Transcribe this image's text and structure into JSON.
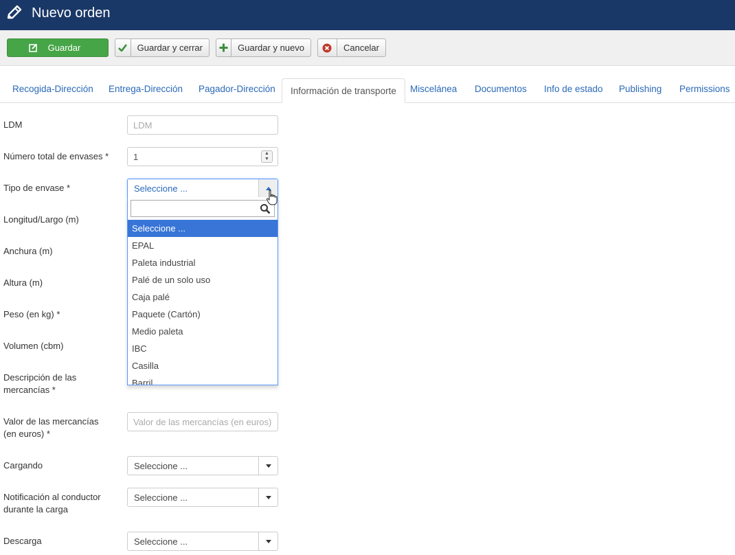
{
  "header": {
    "title": "Nuevo orden"
  },
  "toolbar": {
    "save_label": "Guardar",
    "save_close_label": "Guardar y cerrar",
    "save_new_label": "Guardar y nuevo",
    "cancel_label": "Cancelar"
  },
  "tabs": [
    {
      "label": "Recogida-Dirección"
    },
    {
      "label": "Entrega-Dirección"
    },
    {
      "label": "Pagador-Dirección"
    },
    {
      "label": "Información de transporte"
    },
    {
      "label": "Miscelánea"
    },
    {
      "label": "Documentos"
    },
    {
      "label": "Info de estado"
    },
    {
      "label": "Publishing"
    },
    {
      "label": "Permissions"
    }
  ],
  "form": {
    "ldm": {
      "label": "LDM",
      "placeholder": "LDM",
      "value": ""
    },
    "total_packages": {
      "label": "Número total de envases *",
      "value": "1"
    },
    "package_type": {
      "label": "Tipo de envase *",
      "value": "Seleccione ...",
      "options": [
        "Seleccione ...",
        "EPAL",
        "Paleta industrial",
        "Palé de un solo uso",
        "Caja palé",
        "Paquete (Cartón)",
        "Medio paleta",
        "IBC",
        "Casilla",
        "Barril"
      ]
    },
    "length": {
      "label": "Longitud/Largo (m)"
    },
    "width": {
      "label": "Anchura (m)"
    },
    "height": {
      "label": "Altura (m)"
    },
    "weight": {
      "label": "Peso (en kg) *"
    },
    "volume": {
      "label": "Volumen (cbm)"
    },
    "description": {
      "label_line1": "Descripción de las",
      "label_line2": "mercancías *"
    },
    "goods_value": {
      "label_line1": "Valor de las mercancías",
      "label_line2": "(en euros) *",
      "placeholder": "Valor de las mercancías (en euros)"
    },
    "loading": {
      "label": "Cargando",
      "value": "Seleccione ..."
    },
    "driver_notification": {
      "label_line1": "Notificación al conductor",
      "label_line2": "durante la carga",
      "value": "Seleccione ..."
    },
    "unloading": {
      "label": "Descarga",
      "value": "Seleccione ..."
    }
  }
}
